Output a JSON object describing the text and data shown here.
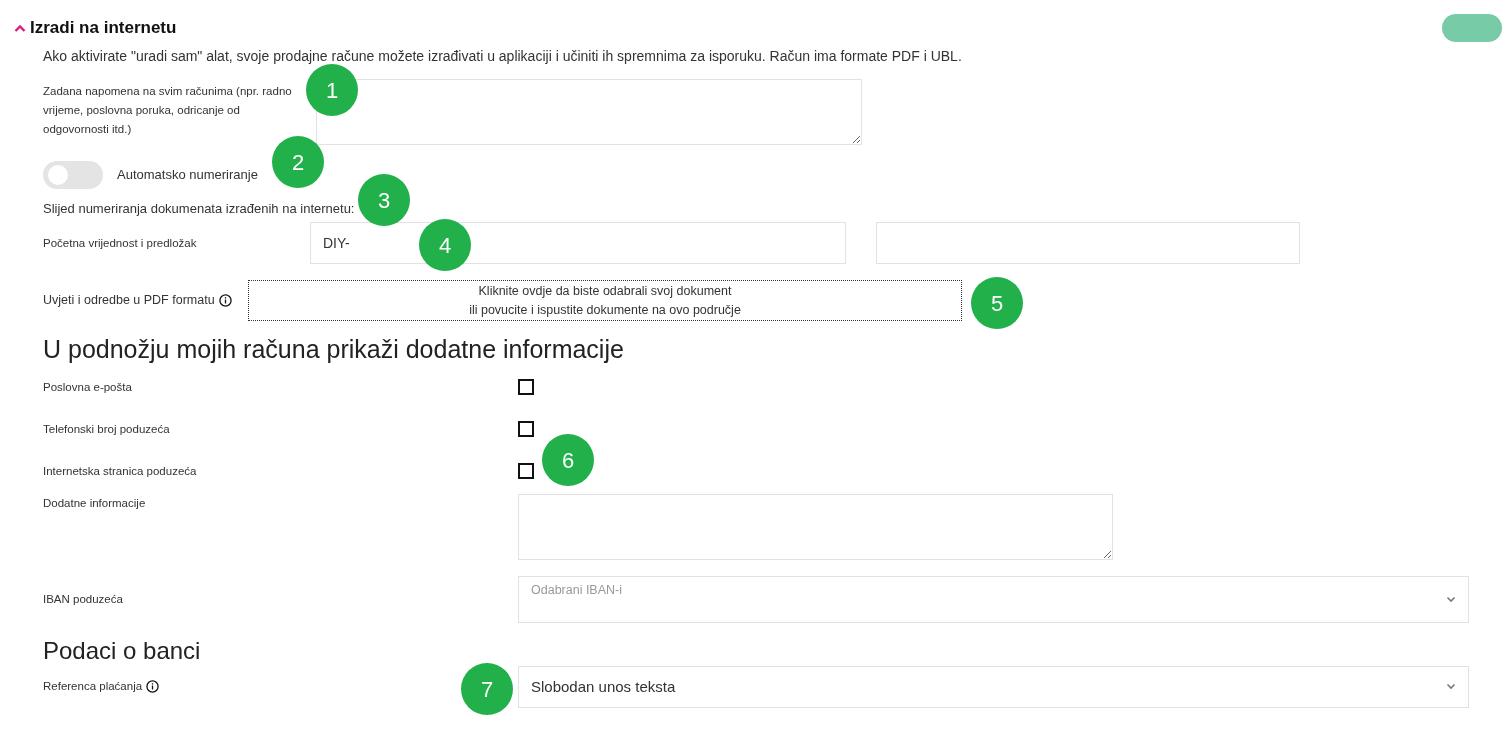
{
  "section": {
    "title": "Izradi na internetu",
    "expanded": true,
    "enabled": true,
    "description": "Ako aktivirate \"uradi sam\" alat, svoje prodajne račune možete izrađivati u aplikaciji i učiniti ih spremnima za isporuku. Račun ima formate PDF i UBL."
  },
  "note": {
    "label": "Zadana napomena na svim računima (npr. radno vrijeme, poslovna poruka, odricanje od odgovornosti itd.)"
  },
  "auto_numbering": {
    "label": "Automatsko numeriranje",
    "on": false
  },
  "sequence": {
    "title": "Slijed numeriranja dokumenata izrađenih na internetu:",
    "label": "Početna vrijednost i predložak",
    "prefix": "DIY-"
  },
  "terms": {
    "label": "Uvjeti i odredbe u PDF formatu",
    "dropzone": [
      "Kliknite ovdje da biste odabrali svoj dokument",
      "ili povucite i ispustite dokumente na ovo područje"
    ]
  },
  "footer_heading": "U podnožju mojih računa prikaži dodatne informacije",
  "footer_options": [
    {
      "label": "Poslovna e-pošta",
      "checked": false
    },
    {
      "label": "Telefonski broj poduzeća",
      "checked": false
    },
    {
      "label": "Internetska stranica poduzeća",
      "checked": false
    }
  ],
  "extra_info": {
    "label": "Dodatne informacije"
  },
  "iban": {
    "label": "IBAN poduzeća",
    "placeholder": "Odabrani IBAN-i"
  },
  "bank_heading": "Podaci o banci",
  "payment_reference": {
    "label": "Referenca plaćanja",
    "value": "Slobodan unos teksta"
  },
  "markers": [
    {
      "number": "1"
    },
    {
      "number": "2"
    },
    {
      "number": "3"
    },
    {
      "number": "4"
    },
    {
      "number": "5"
    },
    {
      "number": "6"
    },
    {
      "number": "7"
    }
  ]
}
